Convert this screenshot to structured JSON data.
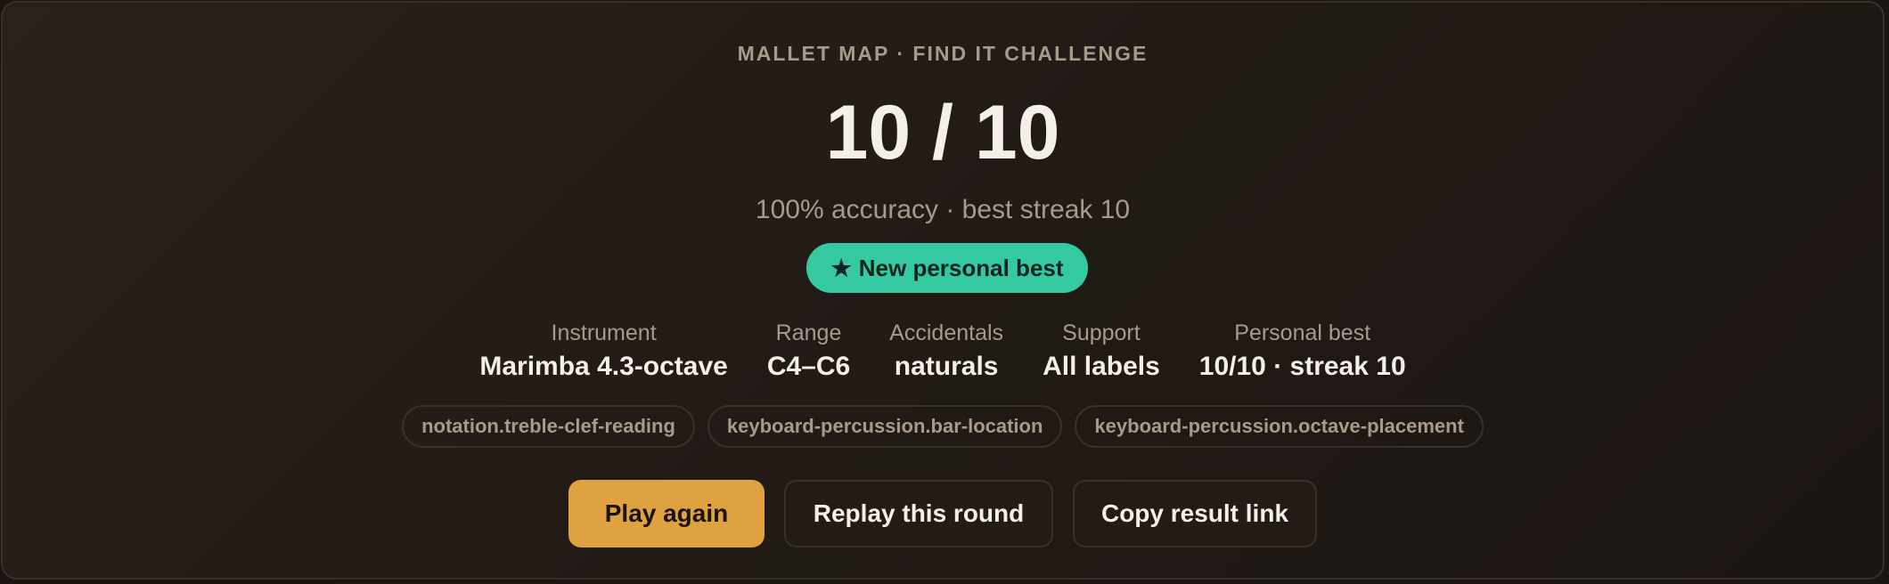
{
  "header": {
    "eyebrow": "MALLET MAP · FIND IT CHALLENGE",
    "score": "10 / 10",
    "summary": "100% accuracy · best streak 10"
  },
  "badge": {
    "icon": "star-icon",
    "label": "New personal best",
    "color": "#34c9a0"
  },
  "stats": [
    {
      "label": "Instrument",
      "value": "Marimba 4.3-octave"
    },
    {
      "label": "Range",
      "value": "C4–C6"
    },
    {
      "label": "Accidentals",
      "value": "naturals"
    },
    {
      "label": "Support",
      "value": "All labels"
    },
    {
      "label": "Personal best",
      "value": "10/10 · streak 10"
    }
  ],
  "tags": [
    "notation.treble-clef-reading",
    "keyboard-percussion.bar-location",
    "keyboard-percussion.octave-placement"
  ],
  "actions": {
    "play_again": "Play again",
    "replay_round": "Replay this round",
    "copy_link": "Copy result link"
  },
  "colors": {
    "accent": "#e0a240",
    "success": "#34c9a0",
    "background": "#221b16"
  }
}
